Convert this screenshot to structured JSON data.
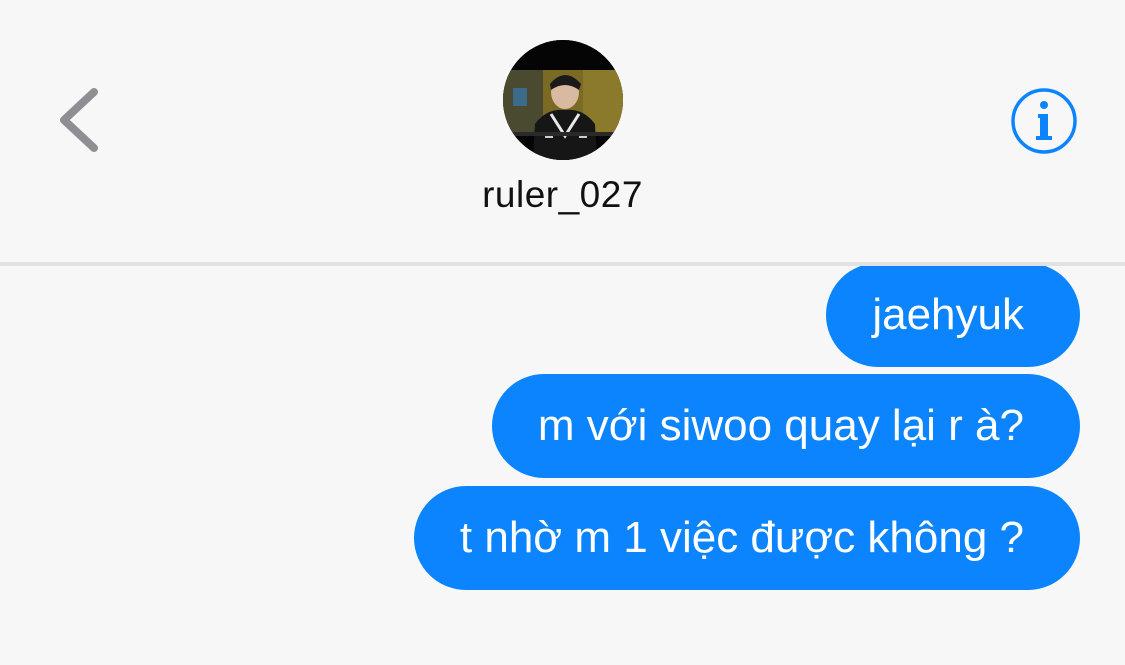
{
  "header": {
    "back_icon": "chevron-left-icon",
    "info_icon": "info-circle-icon",
    "contact_name": "ruler_027",
    "accent_color": "#0b84fe"
  },
  "messages": [
    {
      "sender": "me",
      "text": "jaehyuk"
    },
    {
      "sender": "me",
      "text": "m với siwoo quay lại r à?"
    },
    {
      "sender": "me",
      "text": "t nhờ m 1 việc được không ?"
    }
  ]
}
